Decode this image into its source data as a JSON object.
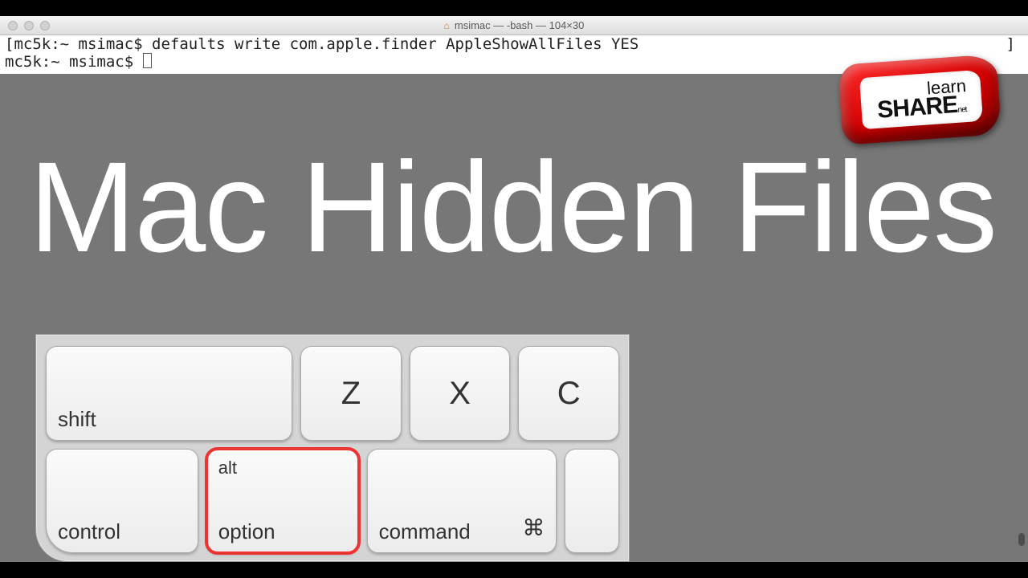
{
  "titlebar": {
    "icon": "home-icon",
    "title": "msimac — -bash — 104×30"
  },
  "terminal": {
    "line1_prefix": "[",
    "line1": "mc5k:~ msimac$ defaults write com.apple.finder AppleShowAllFiles YES",
    "line1_suffix": "]",
    "line2": "mc5k:~ msimac$ "
  },
  "overlay": {
    "title": "Mac Hidden Files"
  },
  "keyboard": {
    "row1": {
      "shift": "shift",
      "z": "Z",
      "x": "X",
      "c": "C"
    },
    "row2": {
      "control": "control",
      "alt_upper": "alt",
      "option": "option",
      "command": "command",
      "command_symbol": "⌘"
    },
    "highlighted_key": "option"
  },
  "logo": {
    "line1": "learn",
    "line2": "SHARE",
    "suffix": "net"
  }
}
